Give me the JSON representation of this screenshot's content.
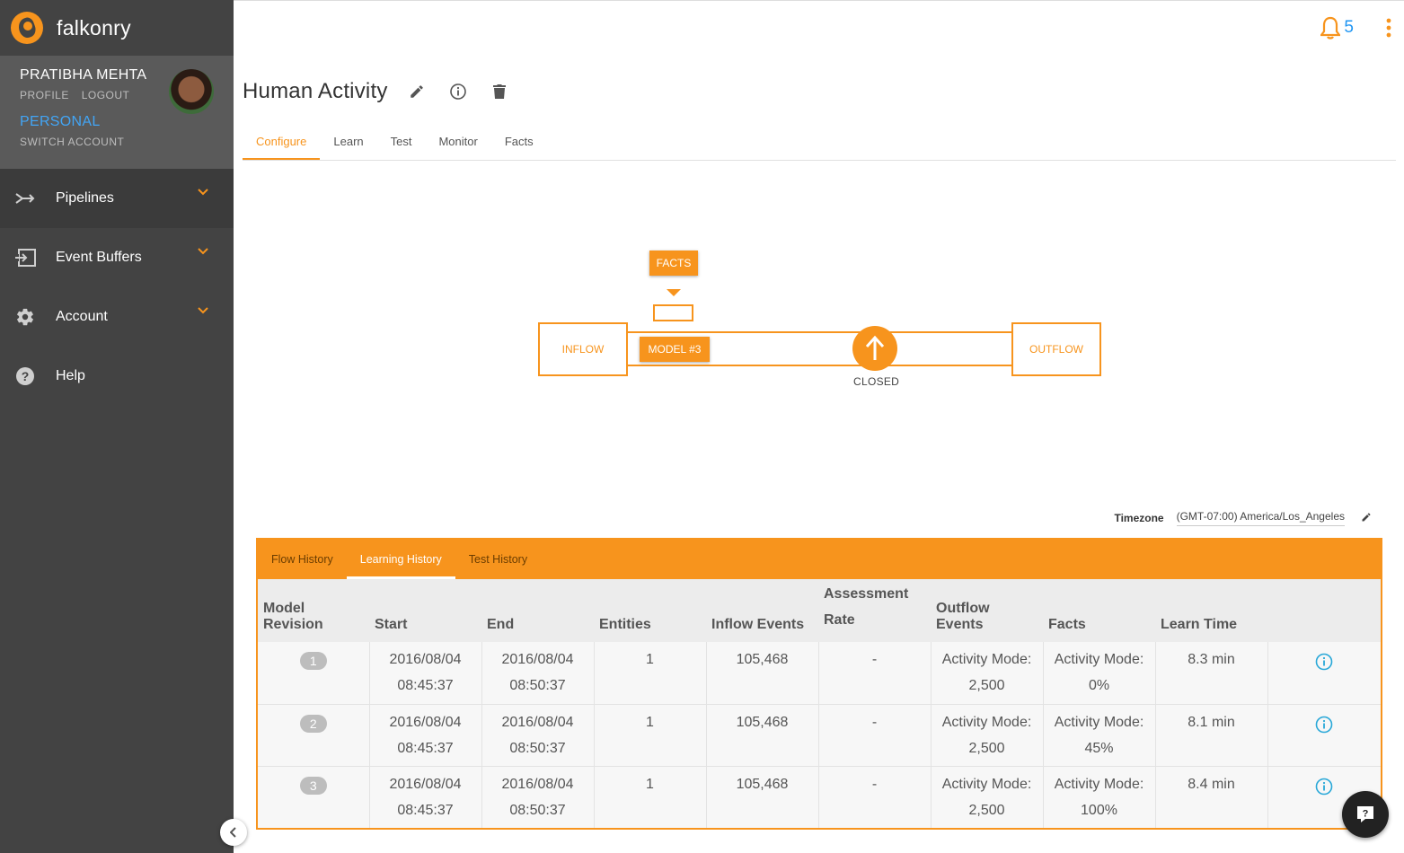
{
  "brand": {
    "name": "falkonry"
  },
  "user": {
    "name": "PRATIBHA MEHTA",
    "profile_link": "PROFILE",
    "logout_link": "LOGOUT",
    "account": "PERSONAL",
    "switch_account": "SWITCH ACCOUNT"
  },
  "nav": {
    "items": [
      {
        "label": "Pipelines",
        "icon": "pipeline-icon"
      },
      {
        "label": "Event Buffers",
        "icon": "event-buffer-icon"
      },
      {
        "label": "Account",
        "icon": "gear-icon"
      },
      {
        "label": "Help",
        "icon": "help-icon"
      }
    ]
  },
  "header": {
    "notification_count": "5"
  },
  "page": {
    "title": "Human Activity",
    "tabs": [
      "Configure",
      "Learn",
      "Test",
      "Monitor",
      "Facts"
    ],
    "active_tab": "Configure"
  },
  "diagram": {
    "facts": "FACTS",
    "inflow": "INFLOW",
    "model": "MODEL #3",
    "outflow": "OUTFLOW",
    "gate_status": "CLOSED"
  },
  "timezone": {
    "label": "Timezone",
    "value": "(GMT-07:00) America/Los_Angeles"
  },
  "history": {
    "tabs": [
      "Flow History",
      "Learning History",
      "Test History"
    ],
    "active_tab": "Learning History",
    "columns": [
      "Model Revision",
      "Start",
      "End",
      "Entities",
      "Inflow Events",
      "Assessment Rate",
      "Outflow Events",
      "Facts",
      "Learn Time"
    ],
    "rows": [
      {
        "revision": "1",
        "start_date": "2016/08/04",
        "start_time": "08:45:37",
        "end_date": "2016/08/04",
        "end_time": "08:50:37",
        "entities": "1",
        "inflow_events": "105,468",
        "assessment_rate": "-",
        "outflow_label": "Activity Mode:",
        "outflow_value": "2,500",
        "facts_label": "Activity Mode:",
        "facts_value": "0%",
        "learn_time": "8.3 min"
      },
      {
        "revision": "2",
        "start_date": "2016/08/04",
        "start_time": "08:45:37",
        "end_date": "2016/08/04",
        "end_time": "08:50:37",
        "entities": "1",
        "inflow_events": "105,468",
        "assessment_rate": "-",
        "outflow_label": "Activity Mode:",
        "outflow_value": "2,500",
        "facts_label": "Activity Mode:",
        "facts_value": "45%",
        "learn_time": "8.1 min"
      },
      {
        "revision": "3",
        "start_date": "2016/08/04",
        "start_time": "08:45:37",
        "end_date": "2016/08/04",
        "end_time": "08:50:37",
        "entities": "1",
        "inflow_events": "105,468",
        "assessment_rate": "-",
        "outflow_label": "Activity Mode:",
        "outflow_value": "2,500",
        "facts_label": "Activity Mode:",
        "facts_value": "100%",
        "learn_time": "8.4 min"
      }
    ]
  },
  "colors": {
    "accent": "#f7941d",
    "sidebar": "#434343",
    "link": "#2196f3",
    "info": "#29a8d8"
  }
}
